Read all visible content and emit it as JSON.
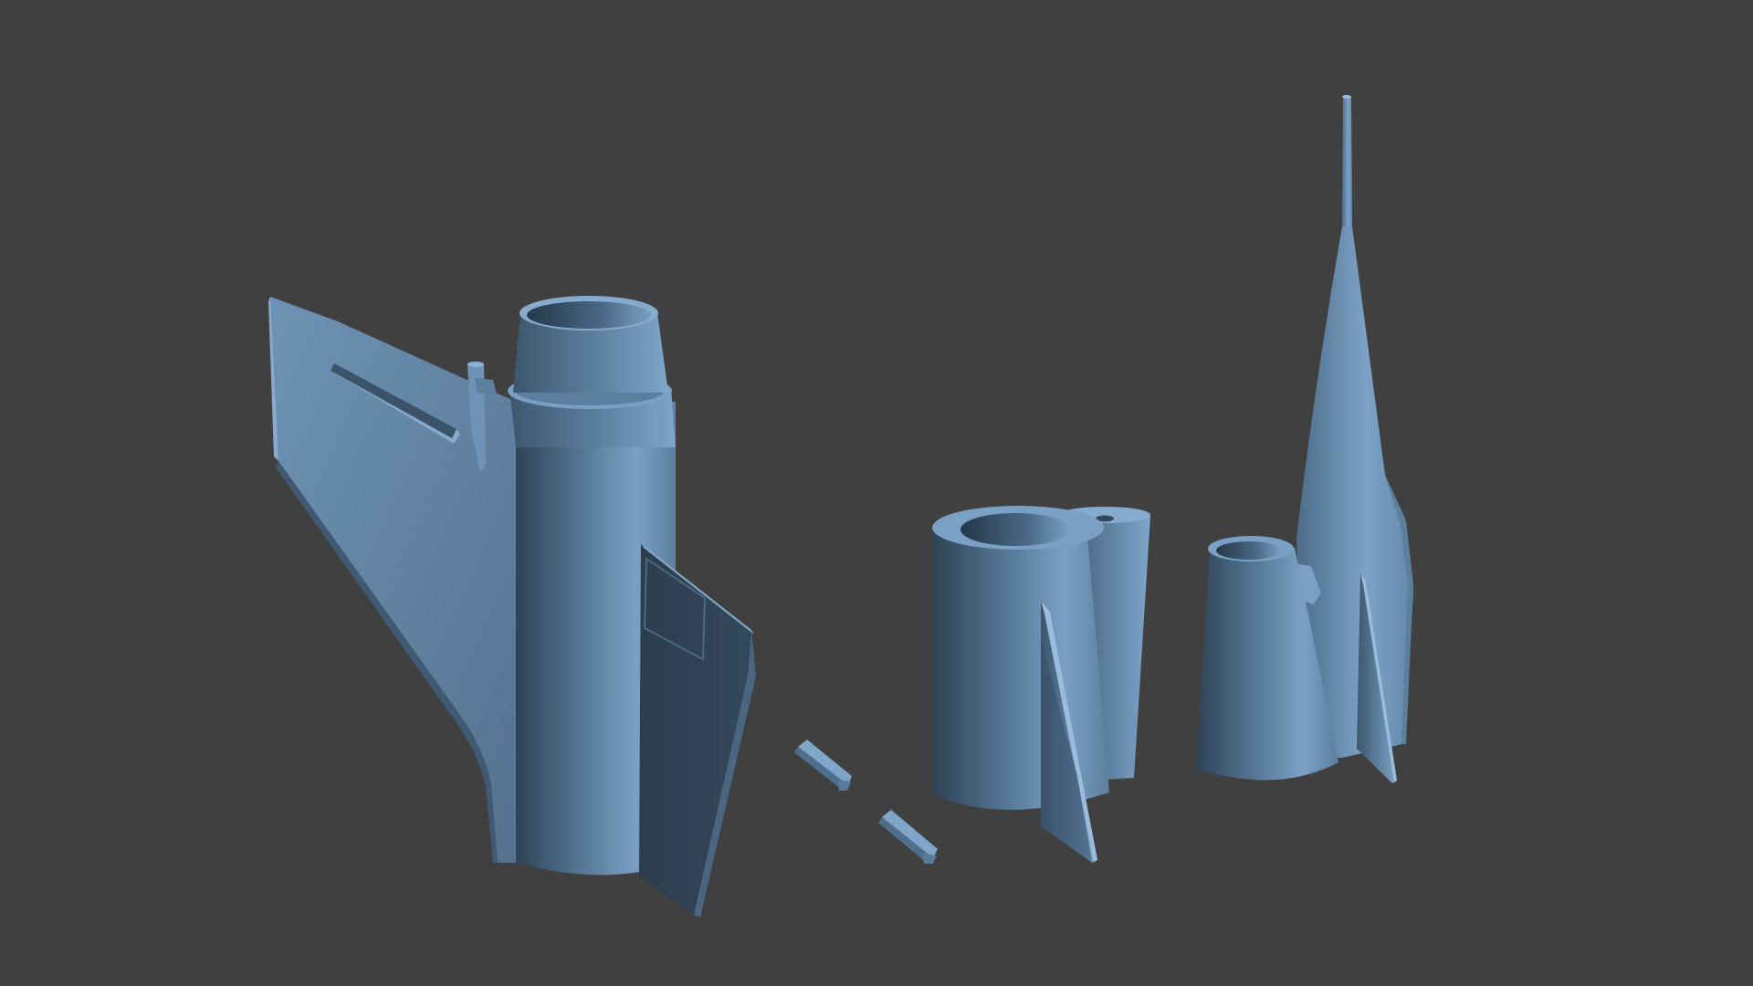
{
  "scene": {
    "background_color": "#404040",
    "material_color": "#6a8fb0",
    "objects": [
      {
        "name": "fuselage-with-wing-and-fin"
      },
      {
        "name": "small-strut-part-upper"
      },
      {
        "name": "small-strut-part-lower"
      },
      {
        "name": "dual-tube-section-with-fin"
      },
      {
        "name": "nose-cone-with-antenna"
      },
      {
        "name": "tapered-tube-section"
      }
    ]
  }
}
